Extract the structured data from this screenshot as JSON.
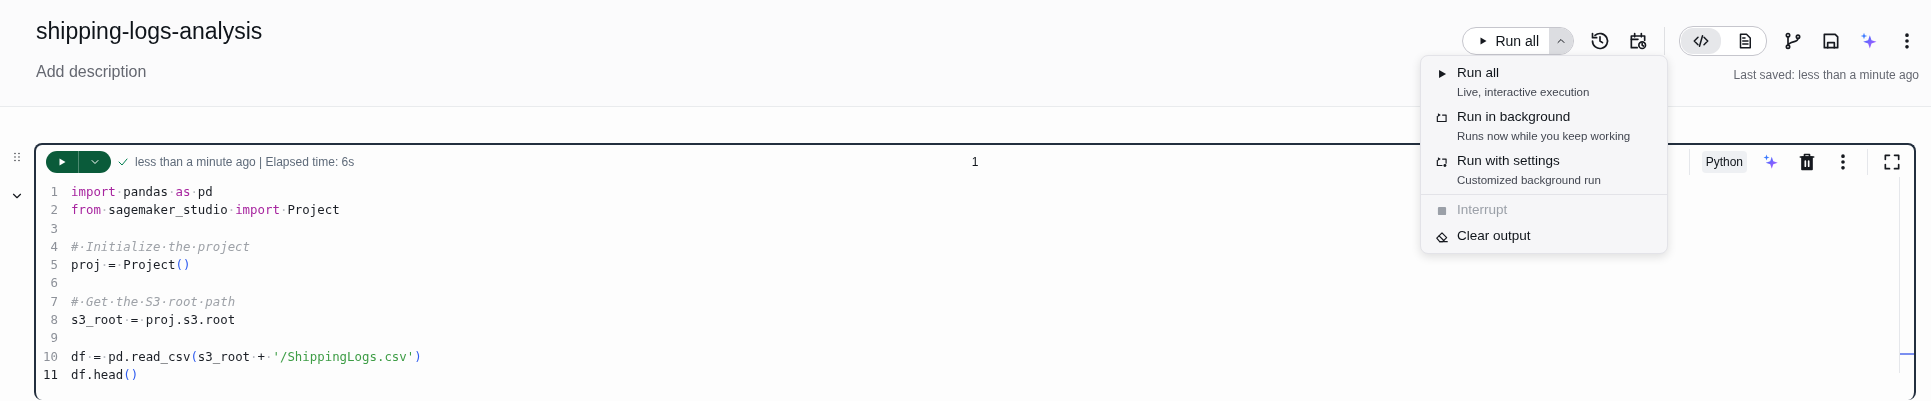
{
  "notebook": {
    "title": "shipping-logs-analysis",
    "description_link": "Add description"
  },
  "toolbar": {
    "run_all": {
      "label": "Run all",
      "expanded": true
    },
    "view_toggle": [
      {
        "kind": "code",
        "selected": true
      },
      {
        "kind": "document",
        "selected": false
      }
    ],
    "last_saved": "Last saved: less than a minute ago"
  },
  "run_menu": {
    "groups": [
      [
        {
          "kind": "play",
          "title": "Run all",
          "subtitle": "Live, interactive execution",
          "disabled": false
        },
        {
          "kind": "background",
          "title": "Run in background",
          "subtitle": "Runs now while you keep working",
          "disabled": false
        },
        {
          "kind": "settings",
          "title": "Run with settings",
          "subtitle": "Customized background run",
          "disabled": false
        }
      ],
      [
        {
          "kind": "stop",
          "title": "Interrupt",
          "disabled": true
        },
        {
          "kind": "eraser",
          "title": "Clear output",
          "disabled": false
        }
      ]
    ]
  },
  "cell": {
    "succeeded": true,
    "status": "less than a minute ago | Elapsed time: 6s",
    "execution_count": "1",
    "language": "Python",
    "lines": [
      {
        "number": "1",
        "current": false,
        "tokens": [
          {
            "kind": "keyword",
            "text": "import"
          },
          {
            "kind": "ws",
            "text": "·"
          },
          {
            "kind": "plain",
            "text": "pandas"
          },
          {
            "kind": "ws",
            "text": "·"
          },
          {
            "kind": "keyword",
            "text": "as"
          },
          {
            "kind": "ws",
            "text": "·"
          },
          {
            "kind": "plain",
            "text": "pd"
          }
        ]
      },
      {
        "number": "2",
        "current": false,
        "tokens": [
          {
            "kind": "keyword",
            "text": "from"
          },
          {
            "kind": "ws",
            "text": "·"
          },
          {
            "kind": "plain",
            "text": "sagemaker_studio"
          },
          {
            "kind": "ws",
            "text": "·"
          },
          {
            "kind": "keyword",
            "text": "import"
          },
          {
            "kind": "ws",
            "text": "·"
          },
          {
            "kind": "plain",
            "text": "Project"
          }
        ]
      },
      {
        "number": "3",
        "current": false
      },
      {
        "number": "4",
        "current": false,
        "tokens": [
          {
            "kind": "comment",
            "text": "#·Initialize·the·project"
          }
        ]
      },
      {
        "number": "5",
        "current": false,
        "tokens": [
          {
            "kind": "plain",
            "text": "proj"
          },
          {
            "kind": "ws",
            "text": "·"
          },
          {
            "kind": "plain",
            "text": "="
          },
          {
            "kind": "ws",
            "text": "·"
          },
          {
            "kind": "plain",
            "text": "Project"
          },
          {
            "kind": "paren",
            "text": "()"
          }
        ]
      },
      {
        "number": "6",
        "current": false
      },
      {
        "number": "7",
        "current": false,
        "tokens": [
          {
            "kind": "comment",
            "text": "#·Get·the·S3·root·path"
          }
        ]
      },
      {
        "number": "8",
        "current": false,
        "tokens": [
          {
            "kind": "plain",
            "text": "s3_root"
          },
          {
            "kind": "ws",
            "text": "·"
          },
          {
            "kind": "plain",
            "text": "="
          },
          {
            "kind": "ws",
            "text": "·"
          },
          {
            "kind": "plain",
            "text": "proj.s3.root"
          }
        ]
      },
      {
        "number": "9",
        "current": false
      },
      {
        "number": "10",
        "current": false,
        "tokens": [
          {
            "kind": "plain",
            "text": "df"
          },
          {
            "kind": "ws",
            "text": "·"
          },
          {
            "kind": "plain",
            "text": "="
          },
          {
            "kind": "ws",
            "text": "·"
          },
          {
            "kind": "plain",
            "text": "pd.read_csv"
          },
          {
            "kind": "paren",
            "text": "("
          },
          {
            "kind": "plain",
            "text": "s3_root"
          },
          {
            "kind": "ws",
            "text": "·"
          },
          {
            "kind": "plain",
            "text": "+"
          },
          {
            "kind": "ws",
            "text": "·"
          },
          {
            "kind": "string",
            "text": "'/ShippingLogs.csv'"
          },
          {
            "kind": "paren",
            "text": ")"
          }
        ]
      },
      {
        "number": "11",
        "current": true,
        "tokens": [
          {
            "kind": "plain",
            "text": "df.head"
          },
          {
            "kind": "paren",
            "text": "()"
          }
        ]
      }
    ]
  }
}
